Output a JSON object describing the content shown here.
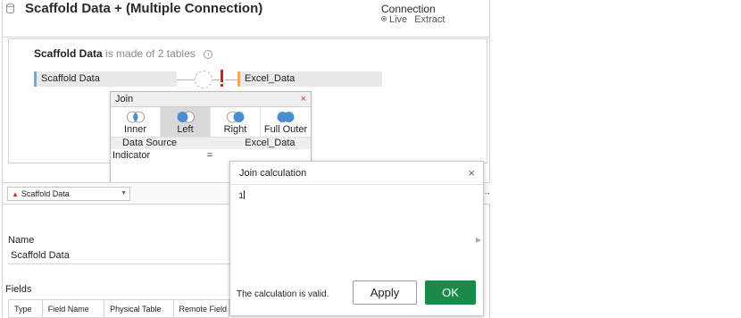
{
  "header": {
    "title": "Scaffold Data + (Multiple Connection)",
    "connection_label": "Connection",
    "live_label": "Live",
    "extract_label": "Extract",
    "live_selected": true
  },
  "canvas": {
    "source_name": "Scaffold Data",
    "made_of_text": "is made of 2 tables",
    "left_table": "Scaffold Data",
    "right_table": "Excel_Data"
  },
  "join_dialog": {
    "title": "Join",
    "close": "×",
    "types": [
      {
        "label": "Inner",
        "icon": "inner-join-icon"
      },
      {
        "label": "Left",
        "icon": "left-join-icon",
        "selected": true
      },
      {
        "label": "Right",
        "icon": "right-join-icon"
      },
      {
        "label": "Full Outer",
        "icon": "full-outer-join-icon"
      }
    ],
    "col_left": "Data Source",
    "col_right": "Excel_Data",
    "row_left": "Indicator",
    "row_operator": "="
  },
  "lower": {
    "datasource_select": "Scaffold Data",
    "name_label": "Name",
    "name_value": "Scaffold Data",
    "fields_label": "Fields",
    "field_columns": [
      "Type",
      "Field Name",
      "Physical Table",
      "Remote Field Name"
    ]
  },
  "calc_dialog": {
    "title": "Join calculation",
    "close": "×",
    "expression": "1",
    "status": "The calculation is valid.",
    "apply_label": "Apply",
    "ok_label": "OK"
  },
  "colors": {
    "ok_green": "#1b8a48",
    "join_blue": "#4a8fd4",
    "error_red": "#c1272d",
    "left_table_accent": "#7aa9c4",
    "right_table_accent": "#f0a860"
  }
}
